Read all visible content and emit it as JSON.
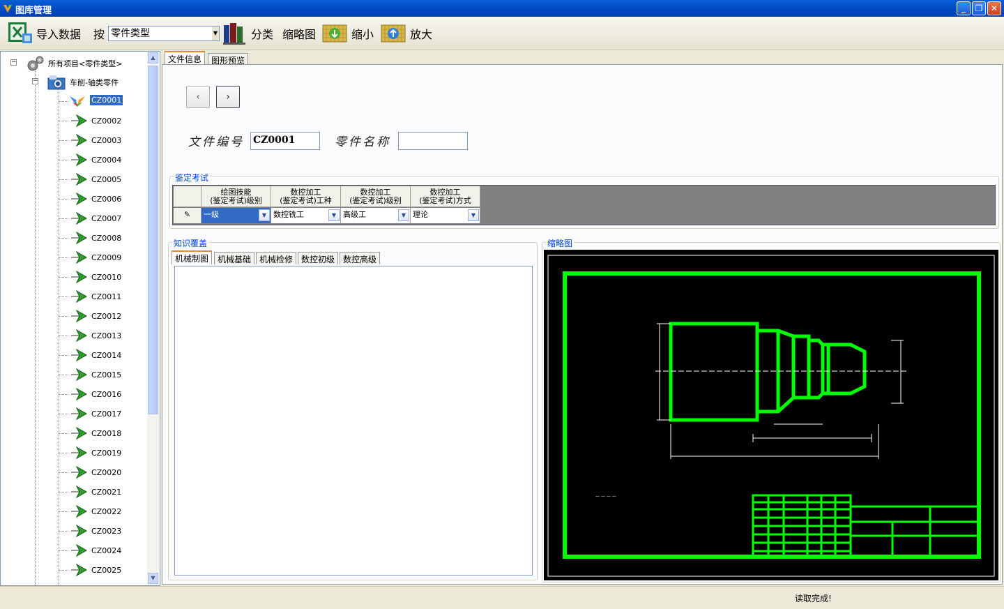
{
  "window": {
    "title": "图库管理",
    "minimize": "_",
    "restore": "❐",
    "close": "✕"
  },
  "toolbar": {
    "import_label": "导入数据",
    "by_label": "按",
    "category_combo_value": "零件类型",
    "classify_label": "分类",
    "thumbnail_label": "缩略图",
    "zoom_out_label": "缩小",
    "zoom_in_label": "放大"
  },
  "tree": {
    "root_label": "所有项目<零件类型>",
    "group_label": "车削-轴类零件",
    "items": [
      "CZ0001",
      "CZ0002",
      "CZ0003",
      "CZ0004",
      "CZ0005",
      "CZ0006",
      "CZ0007",
      "CZ0008",
      "CZ0009",
      "CZ0010",
      "CZ0011",
      "CZ0012",
      "CZ0013",
      "CZ0014",
      "CZ0015",
      "CZ0016",
      "CZ0017",
      "CZ0018",
      "CZ0019",
      "CZ0020",
      "CZ0021",
      "CZ0022",
      "CZ0023",
      "CZ0024",
      "CZ0025"
    ],
    "selected": "CZ0001"
  },
  "tabs": {
    "file_info": "文件信息",
    "preview": "图形预览"
  },
  "nav": {
    "prev": "‹",
    "next": "›"
  },
  "form": {
    "file_no_label": "文件编号",
    "file_no_value": "CZ0001",
    "part_name_label": "零件名称",
    "part_name_value": ""
  },
  "exam": {
    "group_title": "鉴定考试",
    "headers": [
      {
        "l1": "绘图技能",
        "l2": "(鉴定考试)级别"
      },
      {
        "l1": "数控加工",
        "l2": "(鉴定考试)工种"
      },
      {
        "l1": "数控加工",
        "l2": "(鉴定考试)级别"
      },
      {
        "l1": "数控加工",
        "l2": "(鉴定考试)方式"
      }
    ],
    "row": [
      "一级",
      "数控铣工",
      "高级工",
      "理论"
    ],
    "row_marker": "✎"
  },
  "knowledge": {
    "group_title": "知识覆盖",
    "tabs": [
      "机械制图",
      "机械基础",
      "机械检修",
      "数控初级",
      "数控高级"
    ]
  },
  "thumbnail": {
    "group_title": "缩略图"
  },
  "status": {
    "text": "读取完成!"
  },
  "colors": {
    "titlebar": "#0054e3",
    "selection": "#316ac5",
    "drawing_line": "#00ff00",
    "group_title": "#0046d5"
  }
}
